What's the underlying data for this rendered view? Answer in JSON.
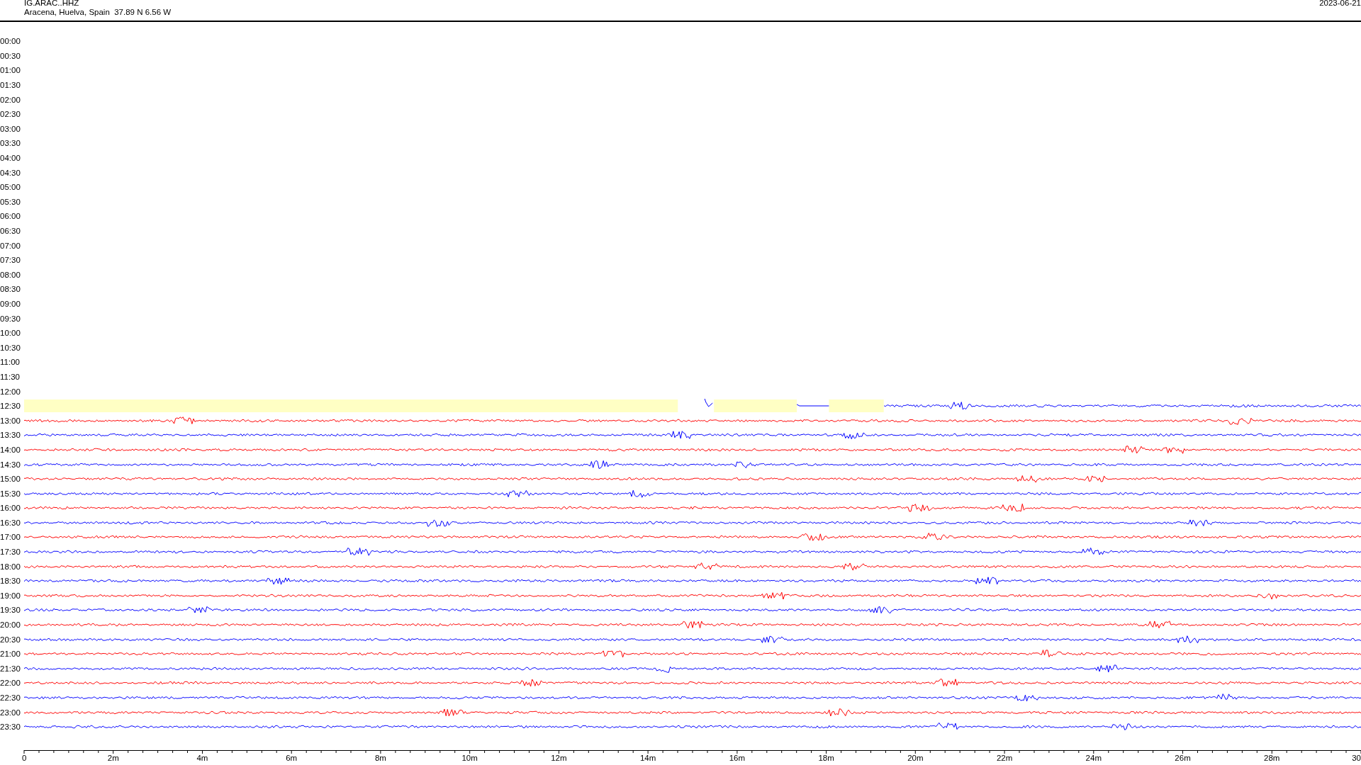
{
  "header": {
    "station": "IG.ARAC..HHZ",
    "location": "Aracena, Huelva, Spain  37.89 N 6.56 W",
    "date": "2023-06-21"
  },
  "rows": [
    {
      "time": "00:00",
      "kind": "empty"
    },
    {
      "time": "00:30",
      "kind": "empty"
    },
    {
      "time": "01:00",
      "kind": "empty"
    },
    {
      "time": "01:30",
      "kind": "empty"
    },
    {
      "time": "02:00",
      "kind": "empty"
    },
    {
      "time": "02:30",
      "kind": "empty"
    },
    {
      "time": "03:00",
      "kind": "empty"
    },
    {
      "time": "03:30",
      "kind": "empty"
    },
    {
      "time": "04:00",
      "kind": "empty"
    },
    {
      "time": "04:30",
      "kind": "empty"
    },
    {
      "time": "05:00",
      "kind": "empty"
    },
    {
      "time": "05:30",
      "kind": "empty"
    },
    {
      "time": "06:00",
      "kind": "empty"
    },
    {
      "time": "06:30",
      "kind": "empty"
    },
    {
      "time": "07:00",
      "kind": "empty"
    },
    {
      "time": "07:30",
      "kind": "empty"
    },
    {
      "time": "08:00",
      "kind": "empty"
    },
    {
      "time": "08:30",
      "kind": "empty"
    },
    {
      "time": "09:00",
      "kind": "empty"
    },
    {
      "time": "09:30",
      "kind": "empty"
    },
    {
      "time": "10:00",
      "kind": "empty"
    },
    {
      "time": "10:30",
      "kind": "empty"
    },
    {
      "time": "11:00",
      "kind": "empty"
    },
    {
      "time": "11:30",
      "kind": "empty"
    },
    {
      "time": "12:00",
      "kind": "empty"
    },
    {
      "time": "12:30",
      "kind": "partial",
      "color": "#0000ff"
    },
    {
      "time": "13:00",
      "kind": "trace",
      "color": "#ff0000"
    },
    {
      "time": "13:30",
      "kind": "trace",
      "color": "#0000ff"
    },
    {
      "time": "14:00",
      "kind": "trace",
      "color": "#ff0000"
    },
    {
      "time": "14:30",
      "kind": "trace",
      "color": "#0000ff"
    },
    {
      "time": "15:00",
      "kind": "trace",
      "color": "#ff0000"
    },
    {
      "time": "15:30",
      "kind": "trace",
      "color": "#0000ff"
    },
    {
      "time": "16:00",
      "kind": "trace",
      "color": "#ff0000"
    },
    {
      "time": "16:30",
      "kind": "trace",
      "color": "#0000ff"
    },
    {
      "time": "17:00",
      "kind": "trace",
      "color": "#ff0000"
    },
    {
      "time": "17:30",
      "kind": "trace",
      "color": "#0000ff"
    },
    {
      "time": "18:00",
      "kind": "trace",
      "color": "#ff0000"
    },
    {
      "time": "18:30",
      "kind": "trace",
      "color": "#0000ff"
    },
    {
      "time": "19:00",
      "kind": "trace",
      "color": "#ff0000"
    },
    {
      "time": "19:30",
      "kind": "trace",
      "color": "#0000ff"
    },
    {
      "time": "20:00",
      "kind": "trace",
      "color": "#ff0000"
    },
    {
      "time": "20:30",
      "kind": "trace",
      "color": "#0000ff"
    },
    {
      "time": "21:00",
      "kind": "trace",
      "color": "#ff0000"
    },
    {
      "time": "21:30",
      "kind": "trace",
      "color": "#0000ff"
    },
    {
      "time": "22:00",
      "kind": "trace",
      "color": "#ff0000"
    },
    {
      "time": "22:30",
      "kind": "trace",
      "color": "#0000ff"
    },
    {
      "time": "23:00",
      "kind": "trace",
      "color": "#ff0000"
    },
    {
      "time": "23:30",
      "kind": "trace",
      "color": "#0000ff"
    }
  ],
  "axis": {
    "labels": [
      "0",
      "2m",
      "4m",
      "6m",
      "8m",
      "10m",
      "12m",
      "14m",
      "16m",
      "18m",
      "20m",
      "22m",
      "24m",
      "26m",
      "28m",
      "30"
    ]
  }
}
